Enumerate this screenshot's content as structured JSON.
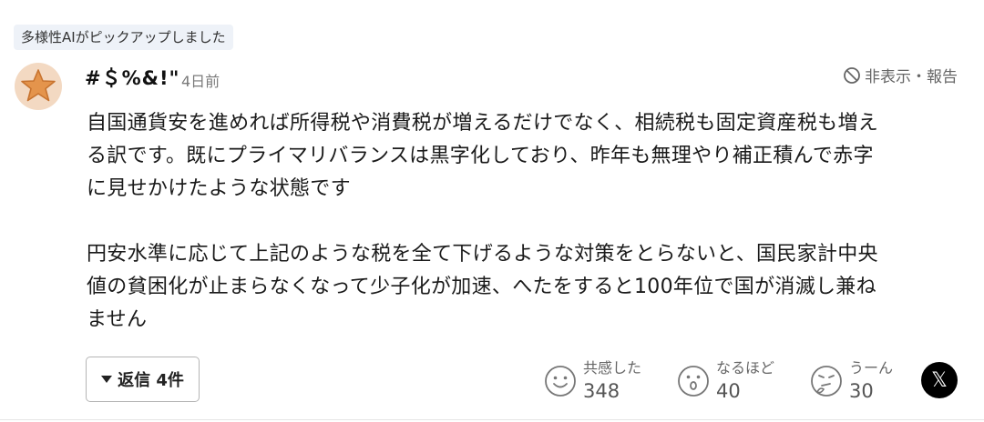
{
  "badge": {
    "text": "多様性AIがピックアップしました"
  },
  "comment": {
    "username": "#＄%&!\"",
    "time_ago": "4日前",
    "hide_report_label": "非表示・報告",
    "body": "自国通貨安を進めれば所得税や消費税が増えるだけでなく、相続税も固定資産税も増え\nる訳です。既にプライマリバランスは黒字化しており、昨年も無理やり補正積んで赤字\nに見せかけたような状態です\n\n円安水準に応じて上記のような税を全て下げるような対策をとらないと、国民家計中央\n値の貧困化が止まらなくなって少子化が加速、へたをすると100年位で国が消滅し兼ね\nません"
  },
  "actions": {
    "reply_label": "返信 4件",
    "reactions": [
      {
        "label": "共感した",
        "count": "348",
        "icon": "smile-face-icon"
      },
      {
        "label": "なるほど",
        "count": "40",
        "icon": "surprised-face-icon"
      },
      {
        "label": "うーん",
        "count": "30",
        "icon": "thinking-face-icon"
      }
    ],
    "share_icon": "x-logo-icon"
  },
  "colors": {
    "avatar_bg": "#f3d9c2",
    "star": "#e4944c",
    "badge_bg": "#eef2f8"
  }
}
